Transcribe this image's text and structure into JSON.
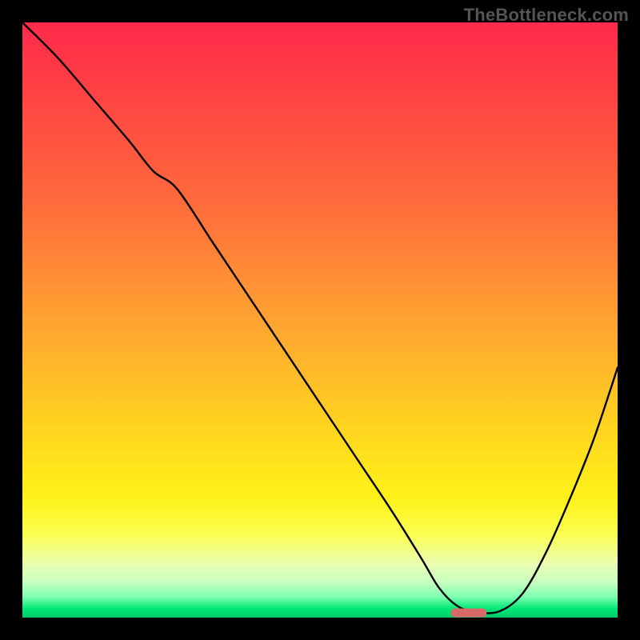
{
  "watermark": "TheBottleneck.com",
  "chart_data": {
    "type": "line",
    "title": "",
    "xlabel": "",
    "ylabel": "",
    "xlim": [
      0,
      100
    ],
    "ylim": [
      0,
      100
    ],
    "grid": false,
    "legend": false,
    "series": [
      {
        "name": "bottleneck-curve",
        "x": [
          0,
          6,
          12,
          18,
          22,
          26,
          32,
          38,
          44,
          50,
          56,
          62,
          67,
          70,
          73,
          76,
          80,
          84,
          88,
          92,
          96,
          100
        ],
        "y": [
          100,
          94,
          87,
          80,
          75,
          72,
          63,
          54,
          45,
          36,
          27,
          18,
          10,
          5,
          2,
          1,
          1,
          4,
          11,
          20,
          30,
          42
        ]
      }
    ],
    "marker": {
      "x_start": 72,
      "x_end": 78,
      "y": 0.8,
      "color": "#d86a69"
    },
    "background_gradient": {
      "top": "#ff2a4b",
      "bottom": "#00c86e",
      "stops": [
        "#ff2a4b",
        "#ff6a3c",
        "#ffa830",
        "#ffd41f",
        "#fff21a",
        "#eaffb2",
        "#00e876"
      ]
    }
  }
}
